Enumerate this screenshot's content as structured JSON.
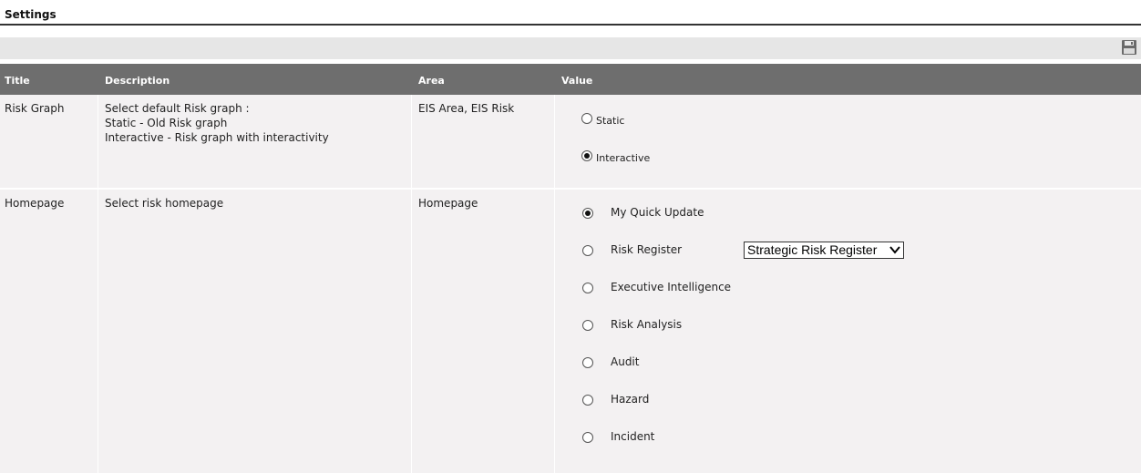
{
  "page": {
    "title": "Settings"
  },
  "toolbar": {
    "save_icon": "save-icon"
  },
  "table": {
    "headers": [
      "Title",
      "Description",
      "Area",
      "Value"
    ],
    "rows": [
      {
        "title": "Risk Graph",
        "description": [
          "Select default Risk graph :",
          "Static - Old Risk graph",
          "Interactive - Risk graph with interactivity"
        ],
        "area": "EIS Area, EIS Risk",
        "options": [
          {
            "label": "Static",
            "checked": false
          },
          {
            "label": "Interactive",
            "checked": true
          }
        ]
      },
      {
        "title": "Homepage",
        "description": [
          "Select risk homepage"
        ],
        "area": "Homepage",
        "options": [
          {
            "label": "My Quick Update",
            "checked": true
          },
          {
            "label": "Risk Register",
            "checked": false
          },
          {
            "label": "Executive Intelligence",
            "checked": false
          },
          {
            "label": "Risk Analysis",
            "checked": false
          },
          {
            "label": "Audit",
            "checked": false
          },
          {
            "label": "Hazard",
            "checked": false
          },
          {
            "label": "Incident",
            "checked": false
          }
        ],
        "risk_register_select": {
          "value": "Strategic Risk Register"
        }
      }
    ]
  }
}
